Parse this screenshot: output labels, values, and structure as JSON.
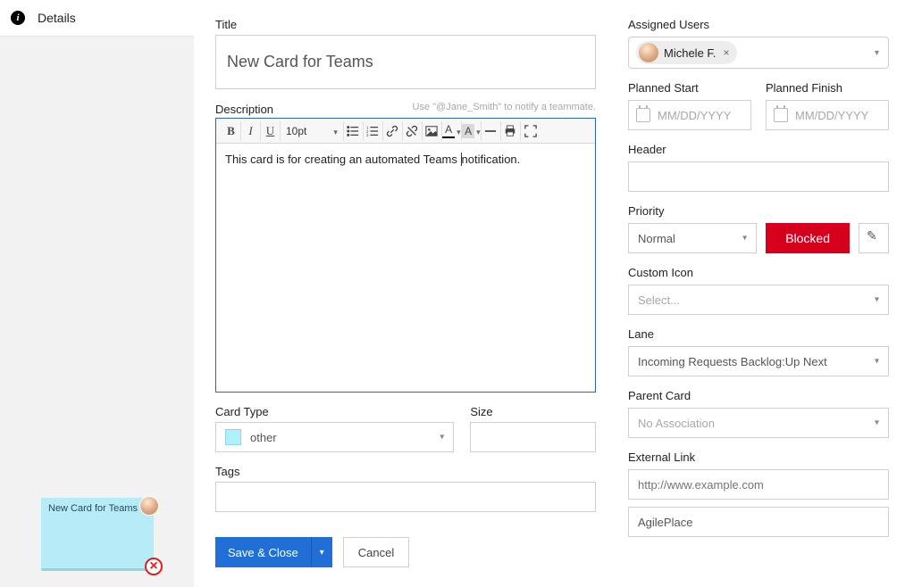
{
  "leftPane": {
    "detailsLabel": "Details",
    "stickyTitle": "New Card for Teams"
  },
  "main": {
    "titleLabel": "Title",
    "titleValue": "New Card for Teams",
    "descLabel": "Description",
    "descHint": "Use \"@Jane_Smith\" to notify a teammate.",
    "toolbar": {
      "bold": "B",
      "italic": "I",
      "underline": "U",
      "fontSize": "10pt",
      "textColor": "A",
      "bgColor": "A"
    },
    "descBodyPart1": "This card is for creating an automated Teams ",
    "descBodyPart2": "notification.",
    "cardTypeLabel": "Card Type",
    "cardTypeValue": "other",
    "sizeLabel": "Size",
    "sizeValue": "",
    "tagsLabel": "Tags",
    "saveLabel": "Save & Close",
    "cancelLabel": "Cancel"
  },
  "right": {
    "assignedLabel": "Assigned Users",
    "assignedUser": "Michele F.",
    "plannedStartLabel": "Planned Start",
    "plannedFinishLabel": "Planned Finish",
    "datePlaceholder": "MM/DD/YYYY",
    "headerLabel": "Header",
    "headerValue": "",
    "priorityLabel": "Priority",
    "priorityValue": "Normal",
    "blockedLabel": "Blocked",
    "customIconLabel": "Custom Icon",
    "customIconPlaceholder": "Select...",
    "laneLabel": "Lane",
    "laneValue": "Incoming Requests Backlog:Up Next",
    "parentCardLabel": "Parent Card",
    "parentCardPlaceholder": "No Association",
    "externalLinkLabel": "External Link",
    "externalLinkPlaceholder": "http://www.example.com",
    "externalLinkNameValue": "AgilePlace"
  }
}
